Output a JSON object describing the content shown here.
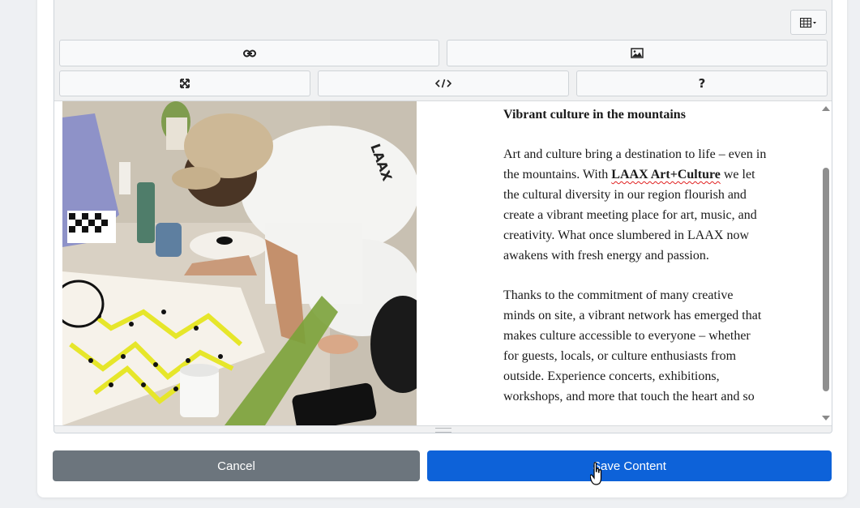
{
  "editor": {
    "toolbar": {
      "table_icon": "table-icon",
      "link_icon": "link-icon",
      "image_icon": "image-icon",
      "fullscreen_icon": "fullscreen-icon",
      "code_icon": "code-view-icon",
      "help_label": "?"
    },
    "content": {
      "image_alt": "photo of a man painting on the floor",
      "heading": "Vibrant culture in the mountains",
      "p1_before": "Art and culture bring a destination to life – even in the mountains. With ",
      "p1_brand": "LAAX Art+Culture",
      "p1_after": " we let the cultural diversity in our region flourish and create a vibrant meeting place for art, music, and creativity. What once slumbered in LAAX now awakens with fresh energy and passion.",
      "p2": "Thanks to the commitment of many creative minds on site, a vibrant network has emerged that makes culture accessible to everyone – whether for guests, locals, or culture enthusiasts from outside. Experience concerts, exhibitions, workshops, and more that touch the heart and so"
    }
  },
  "actions": {
    "cancel_label": "Cancel",
    "save_label": "Save Content"
  },
  "colors": {
    "cancel": "#6c757d",
    "save": "#0d62d9"
  }
}
